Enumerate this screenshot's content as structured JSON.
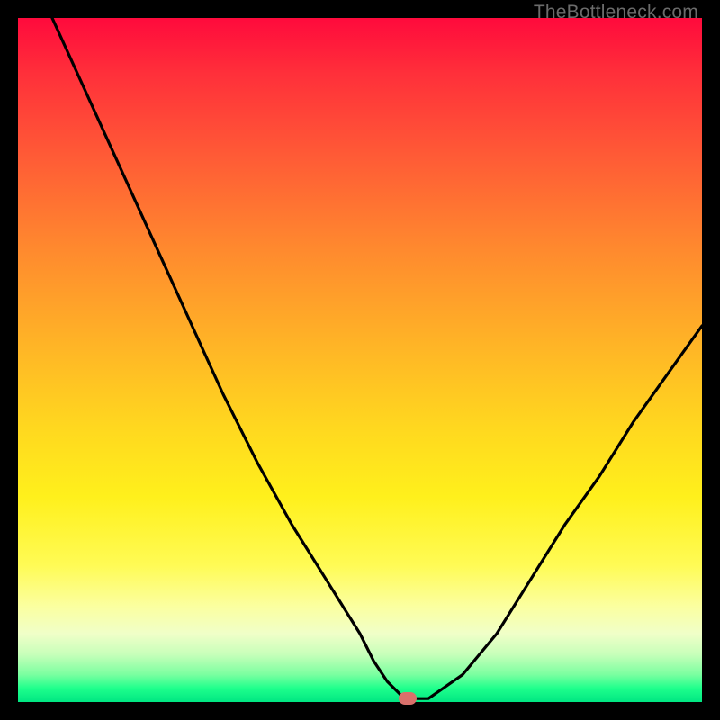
{
  "watermark": "TheBottleneck.com",
  "chart_data": {
    "type": "line",
    "title": "",
    "xlabel": "",
    "ylabel": "",
    "xlim": [
      0,
      100
    ],
    "ylim": [
      0,
      100
    ],
    "grid": false,
    "legend": false,
    "series": [
      {
        "name": "bottleneck-curve",
        "x": [
          5,
          10,
          15,
          20,
          25,
          30,
          35,
          40,
          45,
          50,
          52,
          54,
          56,
          58,
          60,
          65,
          70,
          75,
          80,
          85,
          90,
          95,
          100
        ],
        "values": [
          100,
          89,
          78,
          67,
          56,
          45,
          35,
          26,
          18,
          10,
          6,
          3,
          1,
          0.5,
          0.5,
          4,
          10,
          18,
          26,
          33,
          41,
          48,
          55
        ]
      }
    ],
    "marker": {
      "x": 57,
      "y": 0.5
    },
    "background": {
      "type": "vertical-gradient",
      "stops": [
        {
          "pos": 0,
          "color": "#ff0a3c"
        },
        {
          "pos": 20,
          "color": "#ff5a36"
        },
        {
          "pos": 48,
          "color": "#ffb526"
        },
        {
          "pos": 70,
          "color": "#fff01c"
        },
        {
          "pos": 90,
          "color": "#f0ffc8"
        },
        {
          "pos": 100,
          "color": "#00e682"
        }
      ]
    }
  }
}
